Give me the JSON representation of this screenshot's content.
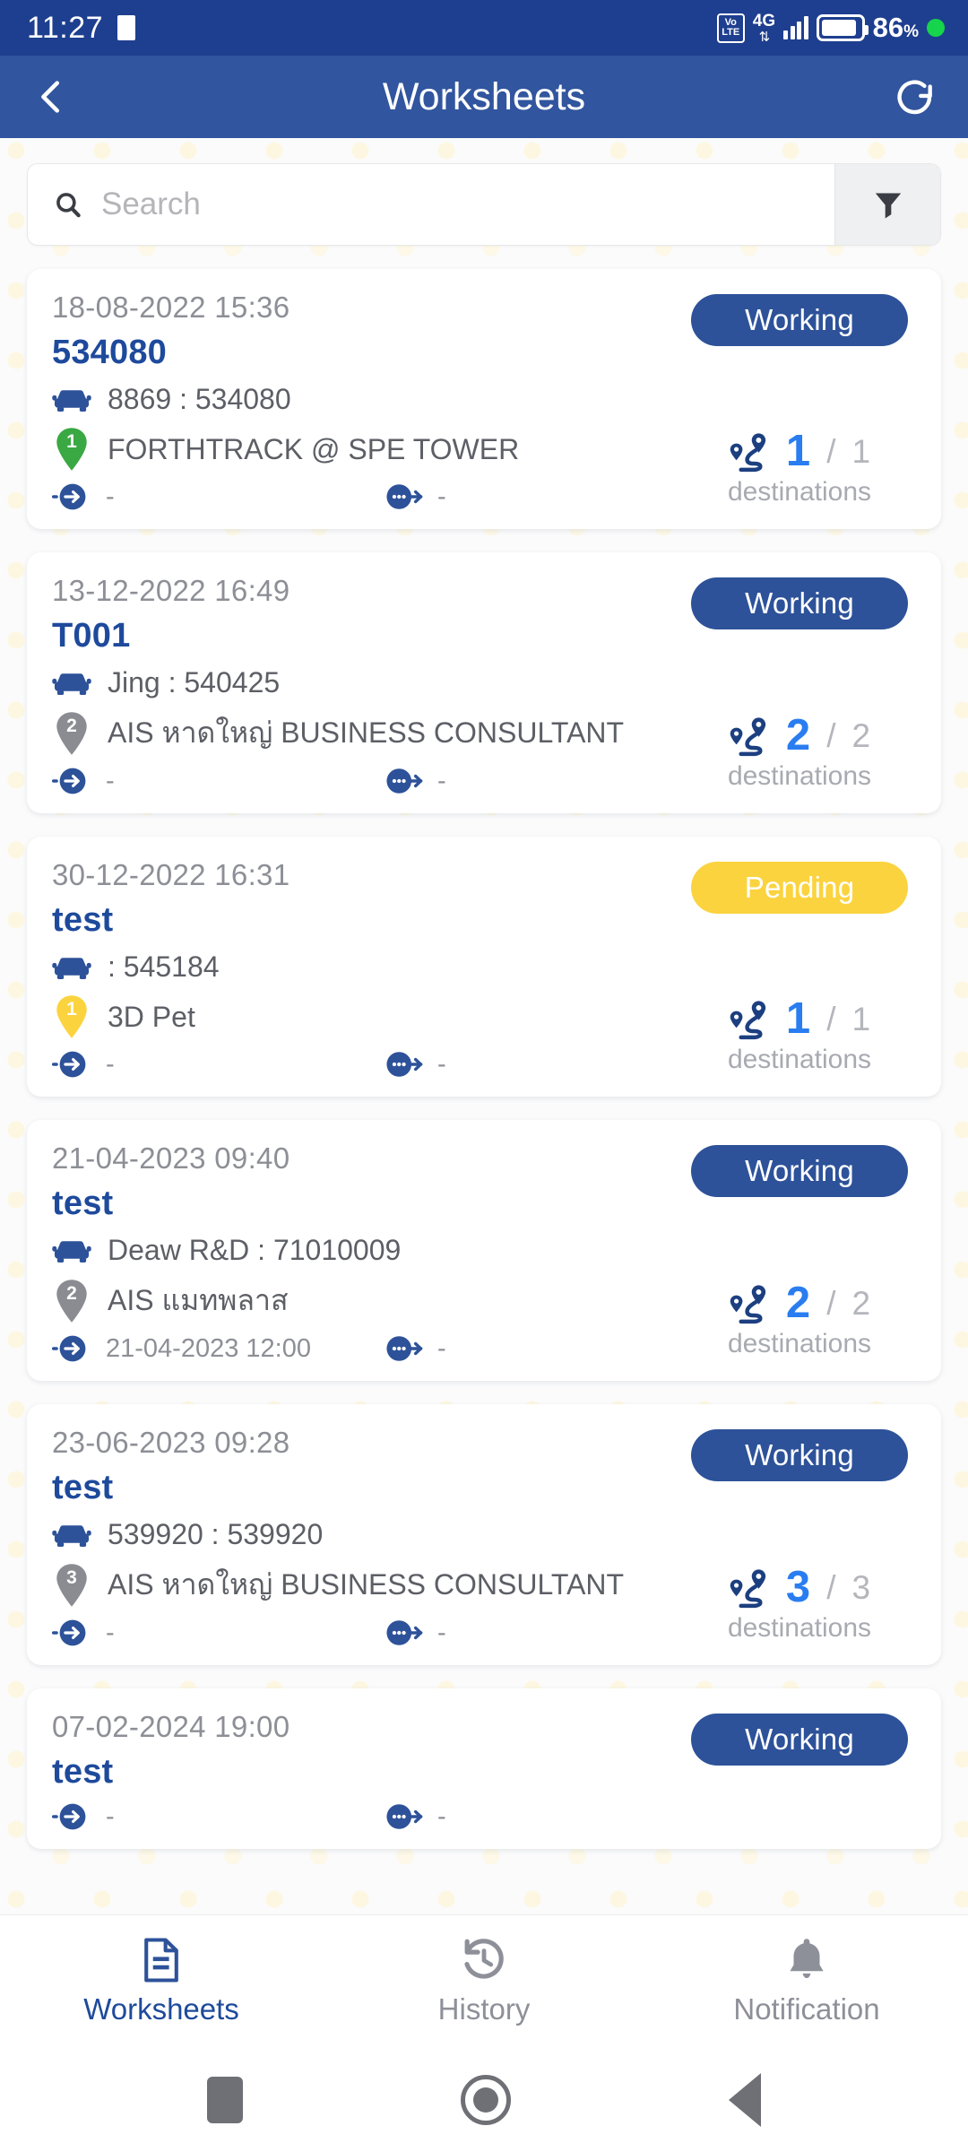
{
  "status_bar": {
    "clock": "11:27",
    "app_icon": "app-indicator-icon",
    "volte_top": "Vo",
    "volte_bottom": "LTE",
    "network": "4G",
    "battery_percent": "86",
    "percent_symbol": "%"
  },
  "app_bar": {
    "back_icon": "chevron-left-icon",
    "title": "Worksheets",
    "refresh_icon": "refresh-icon"
  },
  "search": {
    "placeholder": "Search",
    "search_icon": "search-icon",
    "filter_icon": "filter-icon"
  },
  "colors": {
    "status_bar_bg": "#1e3f8f",
    "app_bar_bg": "#31559e",
    "working_badge": "#2d5299",
    "pending_badge": "#fbd33f",
    "title_blue": "#1e4a9c",
    "count_blue": "#2a7df0",
    "pin_green": "#3aa843",
    "pin_gray": "#8a8c92",
    "pin_yellow": "#fbd33f"
  },
  "labels": {
    "destinations": "destinations",
    "separator": "/"
  },
  "cards": [
    {
      "date": "18-08-2022 15:36",
      "title": "534080",
      "vehicle": "8869 : 534080",
      "place": "FORTHTRACK @ SPE TOWER",
      "pin_number": "1",
      "pin_color": "#3aa843",
      "checkin": "-",
      "checkout": "-",
      "status": "Working",
      "status_color": "#2d5299",
      "dest_current": "1",
      "dest_total": "1"
    },
    {
      "date": "13-12-2022 16:49",
      "title": "T001",
      "vehicle": "Jing : 540425",
      "place": "AIS หาดใหญ่ BUSINESS CONSULTANT",
      "pin_number": "2",
      "pin_color": "#8a8c92",
      "checkin": "-",
      "checkout": "-",
      "status": "Working",
      "status_color": "#2d5299",
      "dest_current": "2",
      "dest_total": "2"
    },
    {
      "date": "30-12-2022 16:31",
      "title": "test",
      "vehicle": ": 545184",
      "place": "3D Pet",
      "pin_number": "1",
      "pin_color": "#fbd33f",
      "checkin": "-",
      "checkout": "-",
      "status": "Pending",
      "status_color": "#fbd33f",
      "dest_current": "1",
      "dest_total": "1"
    },
    {
      "date": "21-04-2023 09:40",
      "title": "test",
      "vehicle": "Deaw R&D : 71010009",
      "place": "AIS แมทพลาส",
      "pin_number": "2",
      "pin_color": "#8a8c92",
      "checkin": "21-04-2023 12:00",
      "checkout": "-",
      "status": "Working",
      "status_color": "#2d5299",
      "dest_current": "2",
      "dest_total": "2"
    },
    {
      "date": "23-06-2023 09:28",
      "title": "test",
      "vehicle": "539920 : 539920",
      "place": "AIS หาดใหญ่ BUSINESS CONSULTANT",
      "pin_number": "3",
      "pin_color": "#8a8c92",
      "checkin": "-",
      "checkout": "-",
      "status": "Working",
      "status_color": "#2d5299",
      "dest_current": "3",
      "dest_total": "3"
    },
    {
      "date": "07-02-2024 19:00",
      "title": "test",
      "vehicle": "",
      "place": "",
      "pin_number": "",
      "pin_color": "#8a8c92",
      "checkin": "-",
      "checkout": "-",
      "status": "Working",
      "status_color": "#2d5299",
      "dest_current": "",
      "dest_total": ""
    }
  ],
  "bottom_nav": [
    {
      "label": "Worksheets",
      "icon": "document-icon",
      "active": true
    },
    {
      "label": "History",
      "icon": "history-clock-icon",
      "active": false
    },
    {
      "label": "Notification",
      "icon": "bell-icon",
      "active": false
    }
  ],
  "system_nav": {
    "recents": "recents-square-icon",
    "home": "home-circle-icon",
    "back": "back-triangle-icon"
  }
}
